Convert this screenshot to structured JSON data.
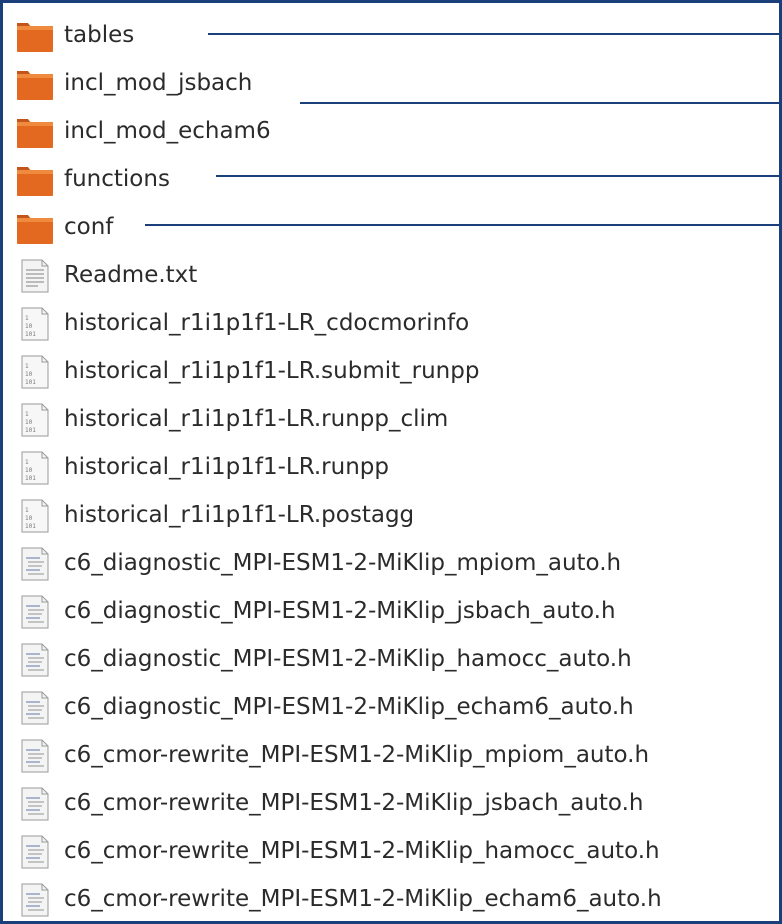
{
  "window": {
    "frame_color": "#1b3f7a",
    "text_color": "#2b2b2b",
    "folder_color": "#e2691f"
  },
  "file_list": [
    {
      "name": "tables",
      "icon": "folder-icon",
      "type": "folder"
    },
    {
      "name": "incl_mod_jsbach",
      "icon": "folder-icon",
      "type": "folder"
    },
    {
      "name": "incl_mod_echam6",
      "icon": "folder-icon",
      "type": "folder"
    },
    {
      "name": "functions",
      "icon": "folder-icon",
      "type": "folder"
    },
    {
      "name": "conf",
      "icon": "folder-icon",
      "type": "folder"
    },
    {
      "name": "Readme.txt",
      "icon": "text-file-icon",
      "type": "text"
    },
    {
      "name": "historical_r1i1p1f1-LR_cdocmorinfo",
      "icon": "binary-file-icon",
      "type": "binary"
    },
    {
      "name": "historical_r1i1p1f1-LR.submit_runpp",
      "icon": "binary-file-icon",
      "type": "binary"
    },
    {
      "name": "historical_r1i1p1f1-LR.runpp_clim",
      "icon": "binary-file-icon",
      "type": "binary"
    },
    {
      "name": "historical_r1i1p1f1-LR.runpp",
      "icon": "binary-file-icon",
      "type": "binary"
    },
    {
      "name": "historical_r1i1p1f1-LR.postagg",
      "icon": "binary-file-icon",
      "type": "binary"
    },
    {
      "name": "c6_diagnostic_MPI-ESM1-2-MiKlip_mpiom_auto.h",
      "icon": "header-file-icon",
      "type": "header"
    },
    {
      "name": "c6_diagnostic_MPI-ESM1-2-MiKlip_jsbach_auto.h",
      "icon": "header-file-icon",
      "type": "header"
    },
    {
      "name": "c6_diagnostic_MPI-ESM1-2-MiKlip_hamocc_auto.h",
      "icon": "header-file-icon",
      "type": "header"
    },
    {
      "name": "c6_diagnostic_MPI-ESM1-2-MiKlip_echam6_auto.h",
      "icon": "header-file-icon",
      "type": "header"
    },
    {
      "name": "c6_cmor-rewrite_MPI-ESM1-2-MiKlip_mpiom_auto.h",
      "icon": "header-file-icon",
      "type": "header"
    },
    {
      "name": "c6_cmor-rewrite_MPI-ESM1-2-MiKlip_jsbach_auto.h",
      "icon": "header-file-icon",
      "type": "header"
    },
    {
      "name": "c6_cmor-rewrite_MPI-ESM1-2-MiKlip_hamocc_auto.h",
      "icon": "header-file-icon",
      "type": "header"
    },
    {
      "name": "c6_cmor-rewrite_MPI-ESM1-2-MiKlip_echam6_auto.h",
      "icon": "header-file-icon",
      "type": "header"
    }
  ]
}
